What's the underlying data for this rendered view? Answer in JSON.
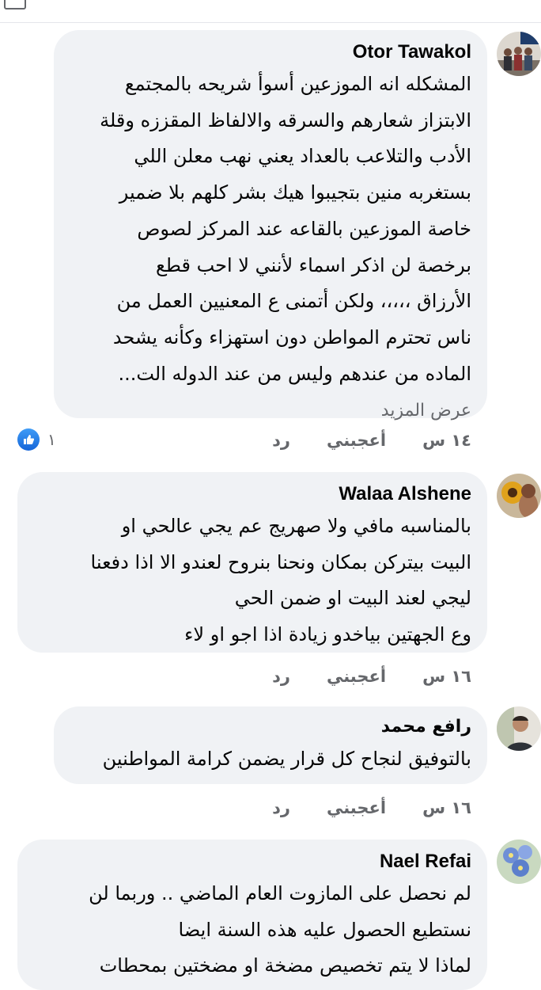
{
  "top_cutoff_text": "",
  "comments": [
    {
      "author": "Otor Tawakol",
      "text": "المشكله انه الموزعين أسوأ شريحه بالمجتمع\nالابتزاز شعارهم والسرقه والالفاظ المقززه وقلة\nالأدب والتلاعب بالعداد يعني نهب معلن اللي\nبستغربه منين بتجيبوا هيك بشر كلهم بلا ضمير\nخاصة الموزعين بالقاعه عند المركز لصوص\nبرخصة لن اذكر اسماء لأنني لا احب قطع\nالأرزاق ،،،،، ولكن أتمنى ع المعنيين العمل من\nناس تحترم المواطن دون استهزاء وكأنه يشحد\nالماده من عندهم وليس من عند الدوله الت...",
      "see_more": "عرض المزيد",
      "time": "١٤ س",
      "like_label": "أعجبني",
      "reply_label": "رد",
      "reactions": "١"
    },
    {
      "author": "Walaa Alshene",
      "text": "بالمناسبه مافي ولا صهريج عم يجي عالحي او\nالبيت بيتركن بمكان ونحنا بنروح لعندو الا اذا دفعنا\nليجي لعند البيت او ضمن الحي\nوع الجهتين بياخدو زيادة اذا اجو او لاء",
      "time": "١٦ س",
      "like_label": "أعجبني",
      "reply_label": "رد"
    },
    {
      "author": "رافع محمد",
      "text": "بالتوفيق لنجاح كل قرار يضمن كرامة المواطنين",
      "time": "١٦ س",
      "like_label": "أعجبني",
      "reply_label": "رد"
    },
    {
      "author": "Nael Refai",
      "text": "لم نحصل على المازوت العام الماضي .. وربما لن\nنستطيع الحصول عليه هذه السنة ايضا\nلماذا لا يتم تخصيص مضخة او مضختين بمحطات",
      "time": "",
      "like_label": "",
      "reply_label": ""
    }
  ],
  "colors": {
    "bubble": "#f0f2f5",
    "secondary_text": "#65676b",
    "like_blue": "#1877f2"
  }
}
